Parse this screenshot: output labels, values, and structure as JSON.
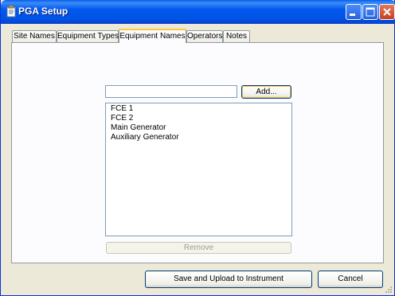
{
  "window": {
    "title": "PGA Setup"
  },
  "tabs": [
    {
      "label": "Site Names"
    },
    {
      "label": "Equipment Types"
    },
    {
      "label": "Equipment Names",
      "active": true
    },
    {
      "label": "Operators"
    },
    {
      "label": "Notes"
    }
  ],
  "equipment_names": {
    "input_value": "",
    "add_label": "Add...",
    "items": [
      "FCE 1",
      "FCE 2",
      "Main Generator",
      "Auxiliary Generator"
    ],
    "remove_label": "Remove"
  },
  "footer": {
    "save_label": "Save and Upload to Instrument",
    "cancel_label": "Cancel"
  }
}
